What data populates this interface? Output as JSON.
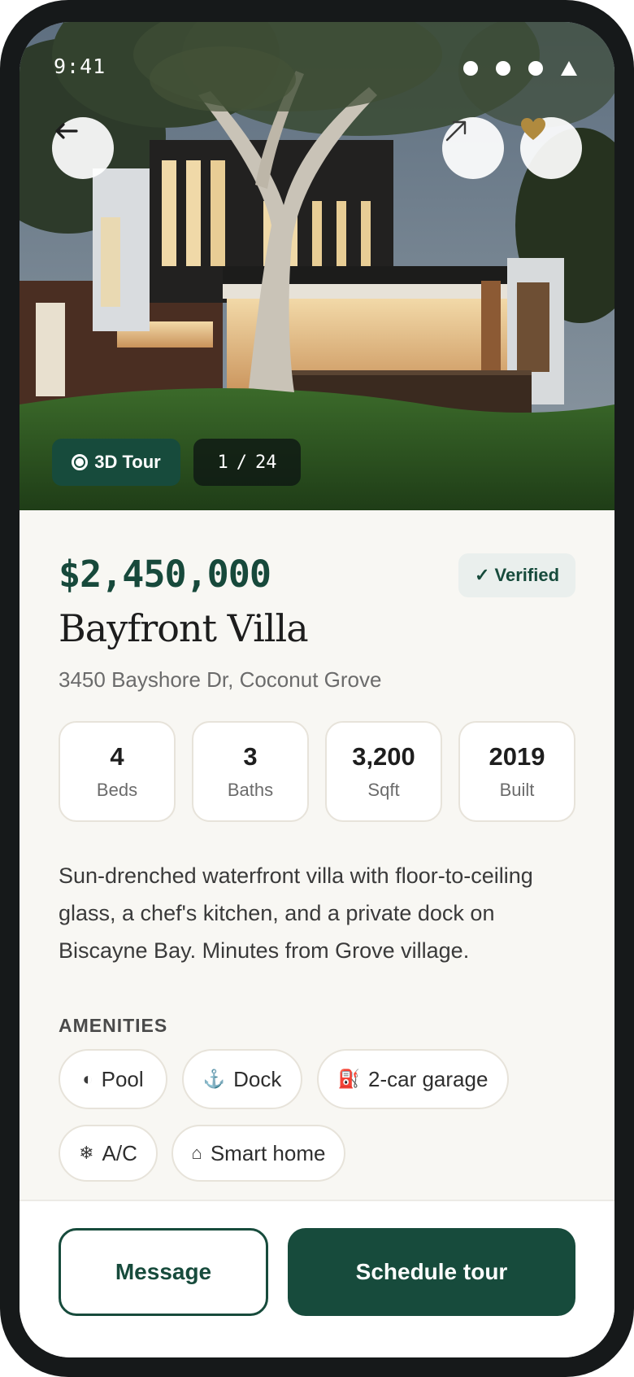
{
  "status_bar": {
    "time": "9:41"
  },
  "hero": {
    "tour_label": "3D Tour",
    "photo_index": "1",
    "photo_separator": "/",
    "photo_total": "24"
  },
  "listing": {
    "price": "$2,450,000",
    "verified_label": "✓ Verified",
    "title": "Bayfront Villa",
    "address": "3450 Bayshore Dr, Coconut Grove",
    "stats": [
      {
        "value": "4",
        "label": "Beds"
      },
      {
        "value": "3",
        "label": "Baths"
      },
      {
        "value": "3,200",
        "label": "Sqft"
      },
      {
        "value": "2019",
        "label": "Built"
      }
    ],
    "description": "Sun-drenched waterfront villa with floor-to-ceiling glass, a chef's kitchen, and a private dock on Biscayne Bay. Minutes from Grove village."
  },
  "amenities": {
    "title": "AMENITIES",
    "items": [
      {
        "icon": "◐",
        "icon_name": "pool-icon",
        "label": "Pool"
      },
      {
        "icon": "⚓",
        "icon_name": "anchor-icon",
        "label": "Dock"
      },
      {
        "icon": "⛽",
        "icon_name": "garage-icon",
        "label": "2-car garage"
      },
      {
        "icon": "❄",
        "icon_name": "snowflake-icon",
        "label": "A/C"
      },
      {
        "icon": "⌂",
        "icon_name": "home-icon",
        "label": "Smart home"
      }
    ]
  },
  "actions": {
    "message_label": "Message",
    "schedule_label": "Schedule tour"
  },
  "colors": {
    "brand_green": "#174b3c",
    "favorite_gold": "#b08a3e",
    "background": "#f8f7f3"
  }
}
